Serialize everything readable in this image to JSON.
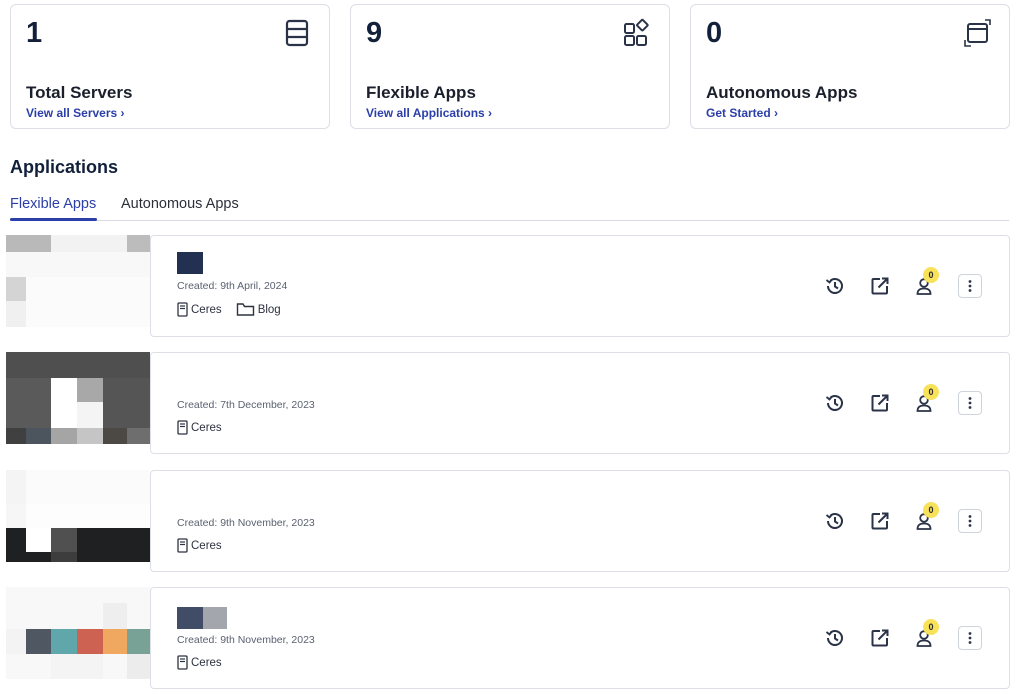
{
  "stats": [
    {
      "number": "1",
      "title": "Total Servers",
      "link": "View all Servers",
      "icon": "server-icon"
    },
    {
      "number": "9",
      "title": "Flexible Apps",
      "link": "View all Applications",
      "icon": "apps-grid-icon"
    },
    {
      "number": "0",
      "title": "Autonomous Apps",
      "link": "Get Started",
      "icon": "window-expand-icon"
    }
  ],
  "section_title": "Applications",
  "tabs": [
    {
      "label": "Flexible Apps",
      "active": true
    },
    {
      "label": "Autonomous Apps",
      "active": false
    }
  ],
  "apps": [
    {
      "created": "Created: 9th April, 2024",
      "server": "Ceres",
      "folder": "Blog",
      "user_count": "0"
    },
    {
      "created": "Created: 7th December, 2023",
      "server": "Ceres",
      "user_count": "0"
    },
    {
      "created": "Created: 9th November, 2023",
      "server": "Ceres",
      "user_count": "0"
    },
    {
      "created": "Created: 9th November, 2023",
      "server": "Ceres",
      "user_count": "0"
    }
  ],
  "colors": {
    "accent": "#2c3fa8",
    "badge": "#f7e25a",
    "border": "#dcdfe6"
  }
}
